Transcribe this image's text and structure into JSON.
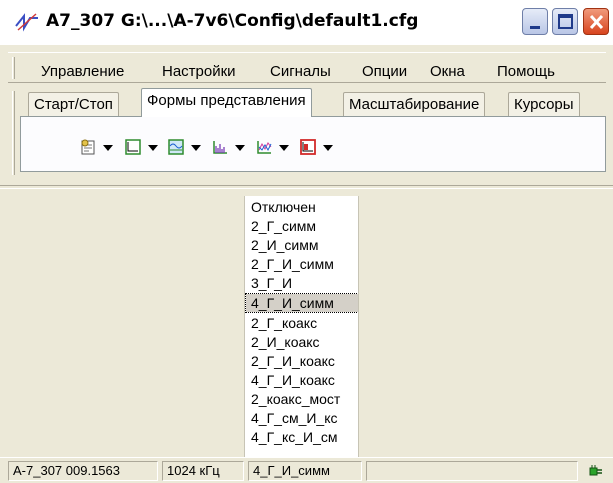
{
  "window": {
    "title": "A7_307  G:\\...\\A-7v6\\Config\\default1.cfg",
    "accent_color": "#d8441e"
  },
  "menu": {
    "items": [
      "Управление",
      "Настройки",
      "Сигналы",
      "Опции",
      "Окна",
      "Помощь"
    ]
  },
  "tabs": {
    "items": [
      "Старт/Стоп",
      "Формы представления",
      "Масштабирование",
      "Курсоры"
    ],
    "active": "Формы представления"
  },
  "toolbar": {
    "buttons": [
      {
        "icon": "settings-page-icon"
      },
      {
        "icon": "graph-window-icon"
      },
      {
        "icon": "waveform-icon"
      },
      {
        "icon": "spectrum-bars-icon"
      },
      {
        "icon": "multi-trace-icon"
      },
      {
        "icon": "red-graph-icon"
      }
    ]
  },
  "listbox": {
    "items": [
      "Отключен",
      "2_Г_симм",
      "2_И_симм",
      "2_Г_И_симм",
      "3_Г_И",
      "4_Г_И_симм",
      "2_Г_коакс",
      "2_И_коакс",
      "2_Г_И_коакс",
      "4_Г_И_коакс",
      "2_коакс_мост",
      "4_Г_см_И_кс",
      "4_Г_кс_И_см"
    ],
    "selected": "4_Г_И_симм"
  },
  "status": {
    "device": "A-7_307 009.1563",
    "frequency": "1024 кГц",
    "mode": "4_Г_И_симм",
    "empty": ""
  }
}
